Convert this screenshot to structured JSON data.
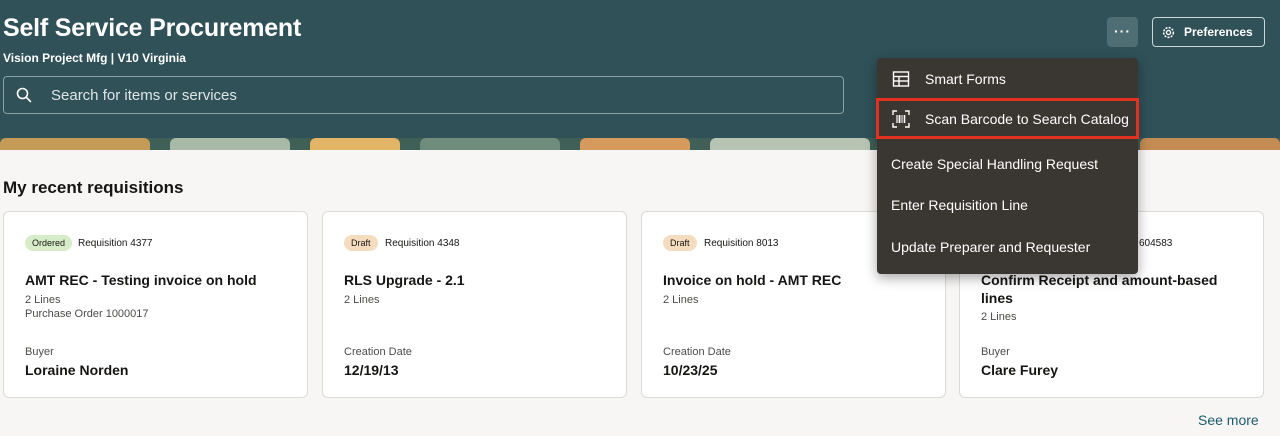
{
  "header": {
    "title": "Self Service Procurement",
    "subtitle": "Vision Project Mfg | V10 Virginia",
    "search_placeholder": "Search for items or services",
    "search_icon": "search-icon",
    "more_label": "···",
    "preferences_label": "Preferences",
    "preferences_icon": "gear-icon"
  },
  "section": {
    "title": "My recent requisitions",
    "see_more": "See more"
  },
  "cards": [
    {
      "status": "Ordered",
      "requisition": "Requisition 4377",
      "title": "AMT REC - Testing invoice on hold",
      "lines": "2 Lines",
      "po": "Purchase Order 1000017",
      "meta_label": "Buyer",
      "meta_value": "Loraine Norden"
    },
    {
      "status": "Draft",
      "requisition": "Requisition 4348",
      "title": "RLS Upgrade - 2.1",
      "lines": "2 Lines",
      "meta_label": "Creation Date",
      "meta_value": "12/19/13"
    },
    {
      "status": "Draft",
      "requisition": "Requisition 8013",
      "title": "Invoice on hold - AMT REC",
      "lines": "2 Lines",
      "meta_label": "Creation Date",
      "meta_value": "10/23/25"
    },
    {
      "requisition_partial": "604583",
      "title": "Confirm Receipt and amount-based lines",
      "lines": "2 Lines",
      "meta_label": "Buyer",
      "meta_value": "Clare Furey"
    }
  ],
  "menu": {
    "items": [
      {
        "label": "Smart Forms",
        "icon": "table-icon"
      },
      {
        "label": "Scan Barcode to Search Catalog",
        "icon": "barcode-scan-icon",
        "highlighted": true
      },
      {
        "label": "Create Special Handling Request"
      },
      {
        "label": "Enter Requisition Line"
      },
      {
        "label": "Update Preparer and Requester"
      }
    ]
  },
  "colors": {
    "header_bg": "#2f5157",
    "menu_bg": "#3a3632",
    "highlight": "#e2321f",
    "ordered_badge": "#d7ecc9",
    "draft_badge": "#f6dcbf",
    "link": "#1d5a6a"
  }
}
